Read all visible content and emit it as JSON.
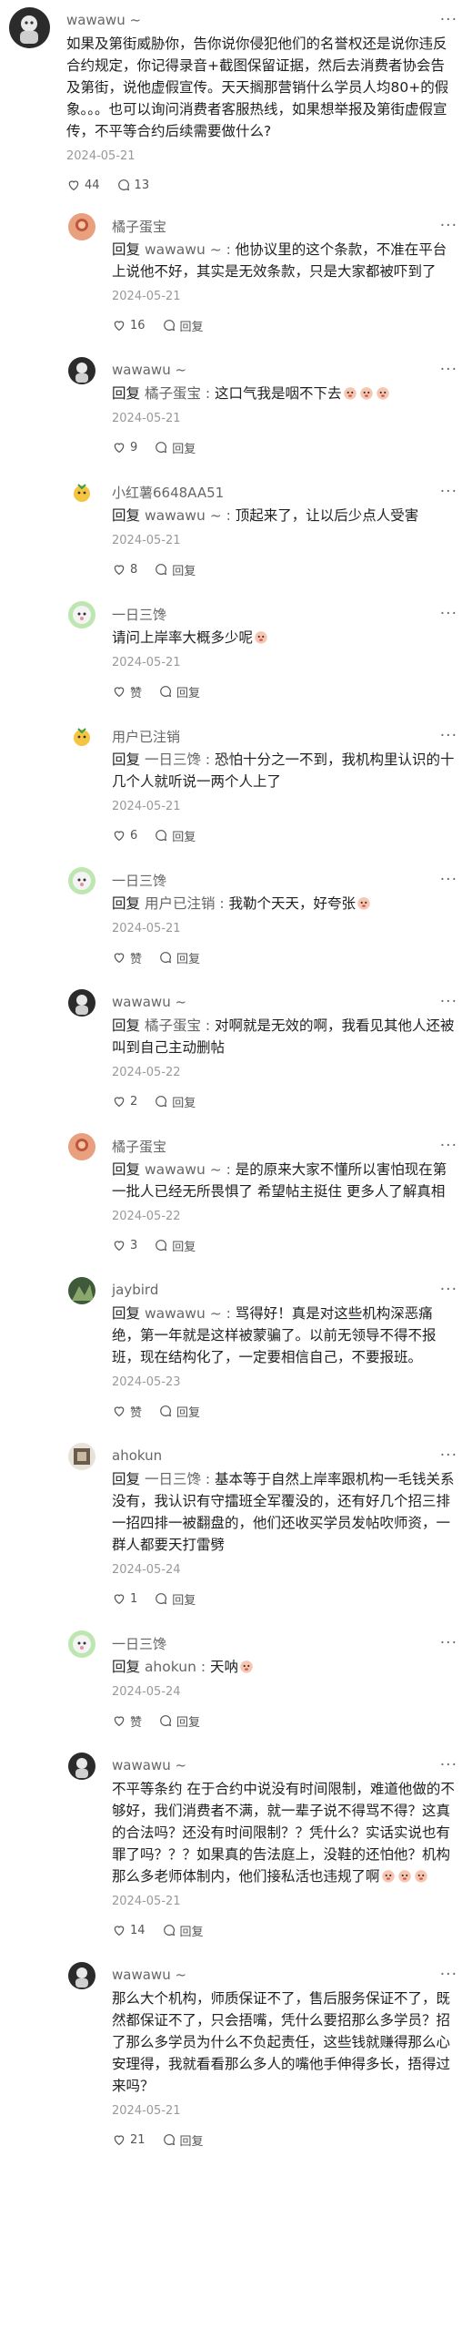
{
  "main_comment": {
    "username": "wawawu ~",
    "text": "如果及第街威胁你，告你说你侵犯他们的名誉权还是说你违反合约规定，你记得录音+截图保留证据，然后去消费者协会告及第街，说他虚假宣传。天天搁那营销什么学员人均80+的假象。。。也可以询问消费者客服热线，如果想举报及第街虚假宣传，不平等合约后续需要做什么?",
    "date": "2024-05-21",
    "likes": "44",
    "comments": "13"
  },
  "labels": {
    "reply_word": "回复",
    "reply_button": "回复",
    "like_word": "赞",
    "more": "···"
  },
  "replies": [
    {
      "username": "橘子蛋宝",
      "mention": "wawawu ~",
      "text": "他协议里的这个条款，不准在平台上说他不好，其实是无效条款，只是大家都被吓到了",
      "date": "2024-05-21",
      "likes": "16",
      "avatar": "orange"
    },
    {
      "username": "wawawu ~",
      "mention": "橘子蛋宝",
      "text": "这口气我是咽不下去",
      "emojis": 3,
      "date": "2024-05-21",
      "likes": "9",
      "avatar": "dark"
    },
    {
      "username": "小红薯6648AA51",
      "mention": "wawawu ~",
      "text": "顶起来了，让以后少点人受害",
      "date": "2024-05-21",
      "likes": "8",
      "avatar": "yellow"
    },
    {
      "username": "一日三馋",
      "mention": "",
      "text": "请问上岸率大概多少呢",
      "emojis": 1,
      "date": "2024-05-21",
      "likes": "赞",
      "avatar": "green"
    },
    {
      "username": "用户已注销",
      "mention": "一日三馋",
      "text": "恐怕十分之一不到，我机构里认识的十几个人就听说一两个人上了",
      "date": "2024-05-21",
      "likes": "6",
      "avatar": "yellow"
    },
    {
      "username": "一日三馋",
      "mention": "用户已注销",
      "text": "我勒个天天，好夸张",
      "emojis": 1,
      "date": "2024-05-21",
      "likes": "赞",
      "avatar": "green"
    },
    {
      "username": "wawawu ~",
      "mention": "橘子蛋宝",
      "text": "对啊就是无效的啊，我看见其他人还被叫到自己主动删帖",
      "date": "2024-05-22",
      "likes": "2",
      "avatar": "dark"
    },
    {
      "username": "橘子蛋宝",
      "mention": "wawawu ~",
      "text": "是的原来大家不懂所以害怕现在第一批人已经无所畏惧了 希望帖主挺住 更多人了解真相",
      "date": "2024-05-22",
      "likes": "3",
      "avatar": "orange"
    },
    {
      "username": "jaybird",
      "mention": "wawawu ~",
      "text": "骂得好！真是对这些机构深恶痛绝，第一年就是这样被蒙骗了。以前无领导不得不报班，现在结构化了，一定要相信自己，不要报班。",
      "date": "2024-05-23",
      "likes": "赞",
      "avatar": "jay"
    },
    {
      "username": "ahokun",
      "mention": "一日三馋",
      "text": "基本等于自然上岸率跟机构一毛钱关系没有，我认识有守擂班全军覆没的，还有好几个招三排一招四排一被翻盘的，他们还收买学员发帖吹师资，一群人都要天打雷劈",
      "date": "2024-05-24",
      "likes": "1",
      "avatar": "aho"
    },
    {
      "username": "一日三馋",
      "mention": "ahokun",
      "text": "天呐",
      "emojis": 1,
      "date": "2024-05-24",
      "likes": "赞",
      "avatar": "green"
    },
    {
      "username": "wawawu ~",
      "mention": "",
      "text": "不平等条约 在于合约中说没有时间限制，难道他做的不够好，我们消费者不满，就一辈子说不得骂不得？这真的合法吗？还没有时间限制？？凭什么？实话实说也有罪了吗？？？如果真的告法庭上，没鞋的还怕他？机构那么多老师体制内，他们接私活也违规了啊",
      "emojis": 3,
      "date": "2024-05-21",
      "likes": "14",
      "avatar": "dark"
    },
    {
      "username": "wawawu ~",
      "mention": "",
      "text": "那么大个机构，师质保证不了，售后服务保证不了，既然都保证不了，只会捂嘴，凭什么要招那么多学员？招了那么多学员为什么不负起责任，这些钱就赚得那么心安理得，我就看看那么多人的嘴他手伸得多长，捂得过来吗？",
      "date": "2024-05-21",
      "likes": "21",
      "avatar": "dark"
    }
  ]
}
